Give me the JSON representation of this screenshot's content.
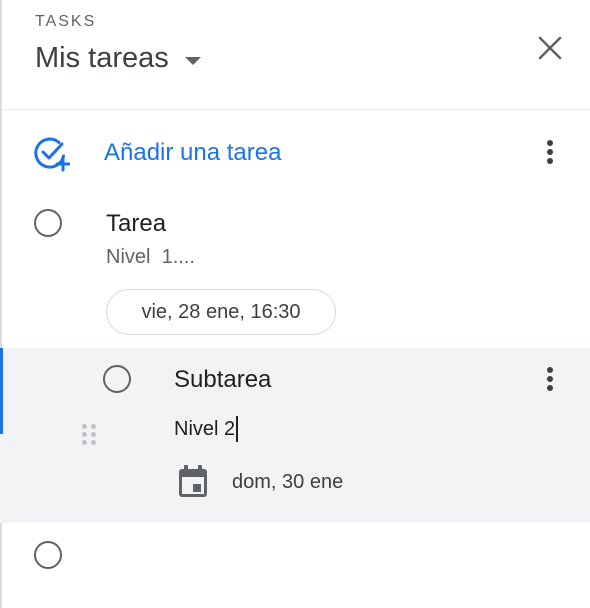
{
  "header": {
    "app_label": "TASKS",
    "list_name": "Mis tareas"
  },
  "icons": {
    "close": "close-icon",
    "add_task": "add-task-icon",
    "more": "more-vert-icon",
    "drag": "drag-handle-icon",
    "calendar": "calendar-icon"
  },
  "colors": {
    "accent": "#1a73e8",
    "subtask_background": "#f1f3f4"
  },
  "add_task": {
    "label": "Añadir una tarea"
  },
  "tasks": [
    {
      "title": "Tarea",
      "notes": "Nivel  1....",
      "due": "vie, 28 ene, 16:30",
      "subtasks": [
        {
          "title": "Subtarea",
          "notes": "Nivel 2",
          "due": "dom, 30 ene"
        }
      ]
    },
    {
      "title": ""
    }
  ]
}
